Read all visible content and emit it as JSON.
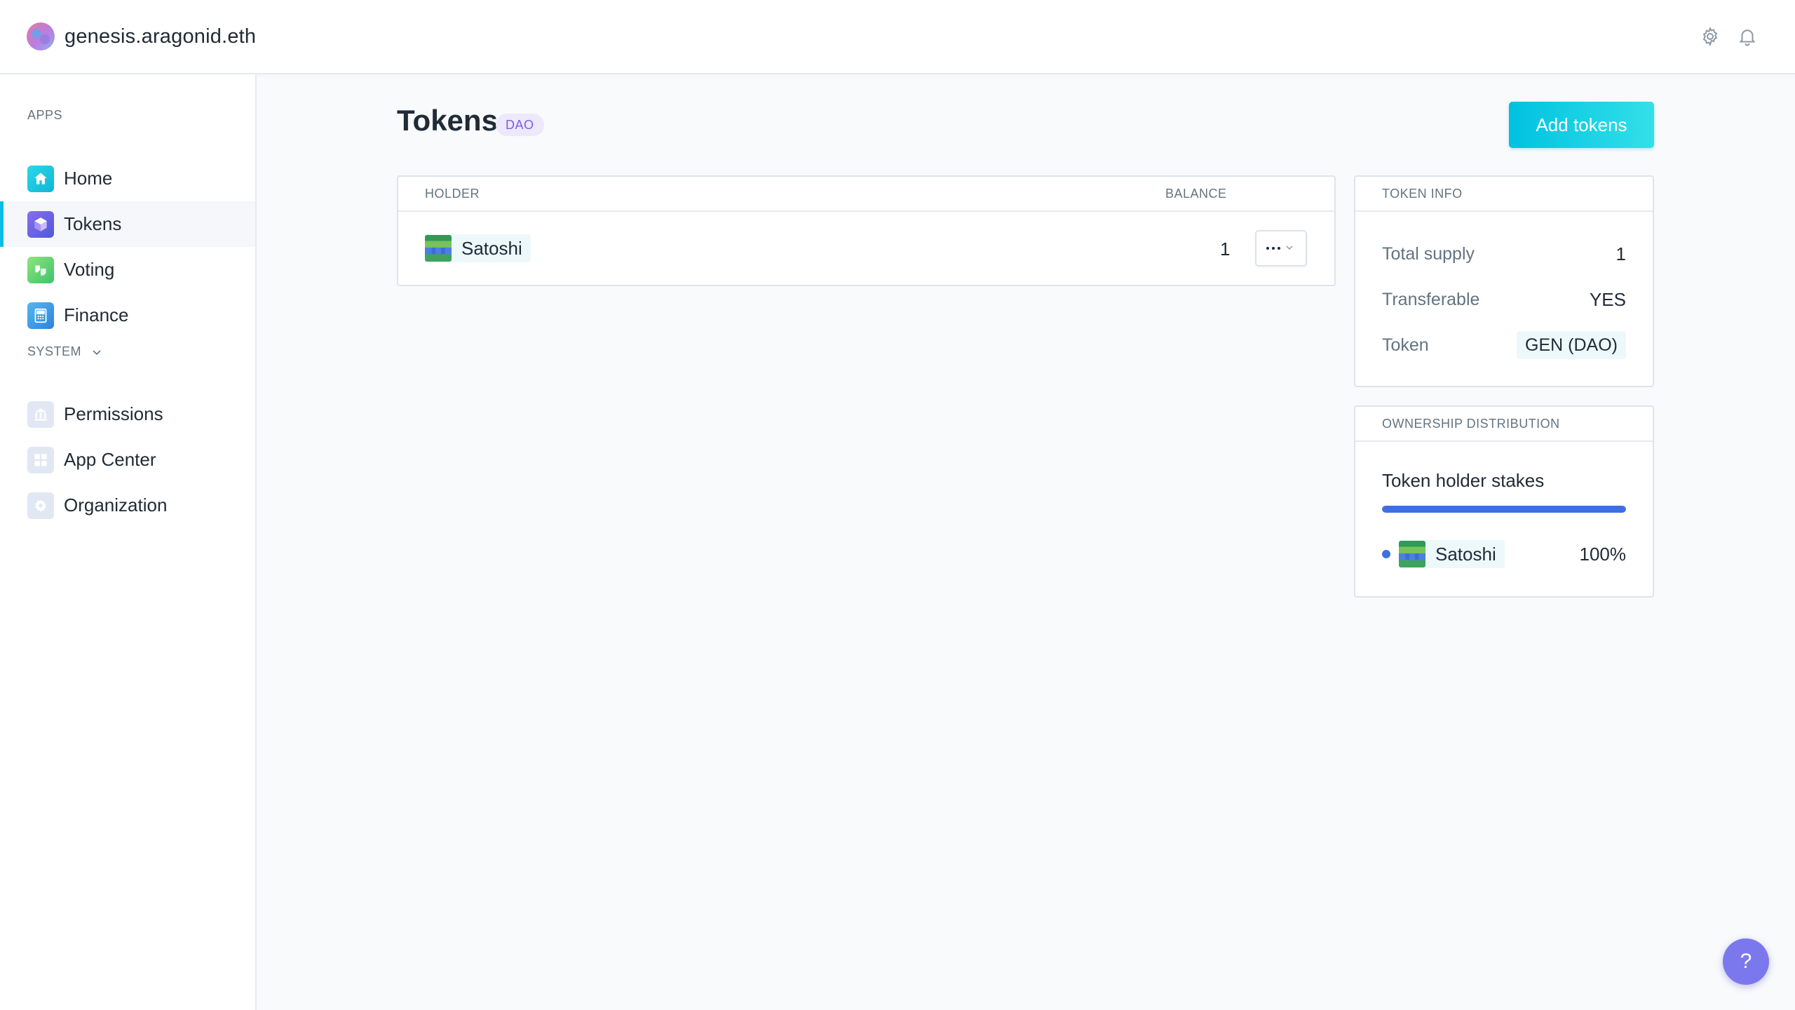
{
  "header": {
    "org_name": "genesis.aragonid.eth",
    "icons": [
      "gear-icon",
      "bell-icon"
    ]
  },
  "sidebar": {
    "apps_label": "APPS",
    "system_label": "SYSTEM",
    "apps": [
      {
        "label": "Home",
        "icon": "home-icon",
        "color": "#12c5d9",
        "active": false
      },
      {
        "label": "Tokens",
        "icon": "tokens-icon",
        "color": "#7257e8",
        "active": true
      },
      {
        "label": "Voting",
        "icon": "voting-icon",
        "color": "#64d36f",
        "active": false
      },
      {
        "label": "Finance",
        "icon": "finance-icon",
        "color": "#3aa1e8",
        "active": false
      }
    ],
    "system": [
      {
        "label": "Permissions",
        "icon": "permissions-icon"
      },
      {
        "label": "App Center",
        "icon": "app-center-icon"
      },
      {
        "label": "Organization",
        "icon": "organization-icon"
      }
    ]
  },
  "main": {
    "title": "Tokens",
    "tag": "DAO",
    "add_button": "Add tokens",
    "holders_table": {
      "columns": [
        "HOLDER",
        "BALANCE"
      ],
      "rows": [
        {
          "holder": "Satoshi",
          "balance": "1"
        }
      ]
    },
    "token_info": {
      "heading": "TOKEN INFO",
      "rows": [
        {
          "key": "Total supply",
          "value": "1"
        },
        {
          "key": "Transferable",
          "value": "YES"
        },
        {
          "key": "Token",
          "value": "GEN (DAO)"
        }
      ]
    },
    "ownership": {
      "heading": "OWNERSHIP DISTRIBUTION",
      "subtitle": "Token holder stakes",
      "holders": [
        {
          "name": "Satoshi",
          "percent_label": "100%",
          "share": 1.0
        }
      ]
    }
  },
  "help_button": "?",
  "colors": {
    "accent": "#08bee5",
    "stake_blue": "#3e6fe0",
    "dao_tag": "#7a5fe0",
    "help": "#7b78ed"
  }
}
